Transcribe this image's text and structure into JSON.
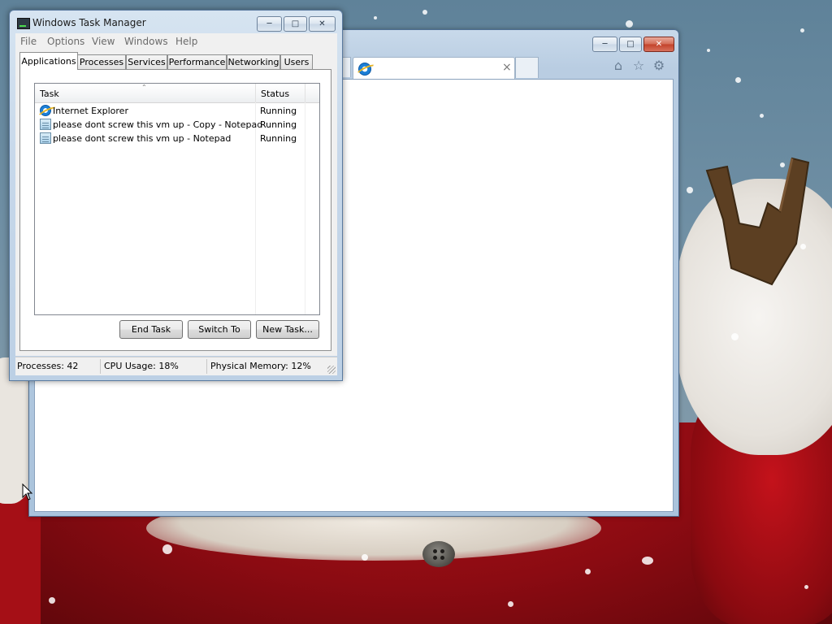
{
  "task_manager": {
    "title": "Windows Task Manager",
    "menu": [
      "File",
      "Options",
      "View",
      "Windows",
      "Help"
    ],
    "tabs": [
      "Applications",
      "Processes",
      "Services",
      "Performance",
      "Networking",
      "Users"
    ],
    "active_tab": "Applications",
    "list": {
      "columns": [
        "Task",
        "Status"
      ],
      "rows": [
        {
          "task": "Internet Explorer",
          "status": "Running",
          "icon": "internet-explorer-icon"
        },
        {
          "task": "please dont screw this vm up - Copy - Notepad",
          "status": "Running",
          "icon": "notepad-icon"
        },
        {
          "task": "please dont screw this vm up - Notepad",
          "status": "Running",
          "icon": "notepad-icon"
        }
      ]
    },
    "buttons": {
      "end_task": "End Task",
      "switch_to": "Switch To",
      "new_task": "New Task..."
    },
    "status_bar": {
      "processes": "Processes: 42",
      "cpu": "CPU Usage: 18%",
      "memory": "Physical Memory: 12%"
    }
  },
  "browser": {
    "app": "Internet Explorer",
    "tab_close_glyph": "×",
    "toolbar_icons": [
      "home-icon",
      "favorites-star-icon",
      "settings-gear-icon"
    ]
  },
  "colors": {
    "titlebar": "#c7d8ea",
    "close_button": "#c2422a",
    "coat_red": "#b3121a"
  }
}
